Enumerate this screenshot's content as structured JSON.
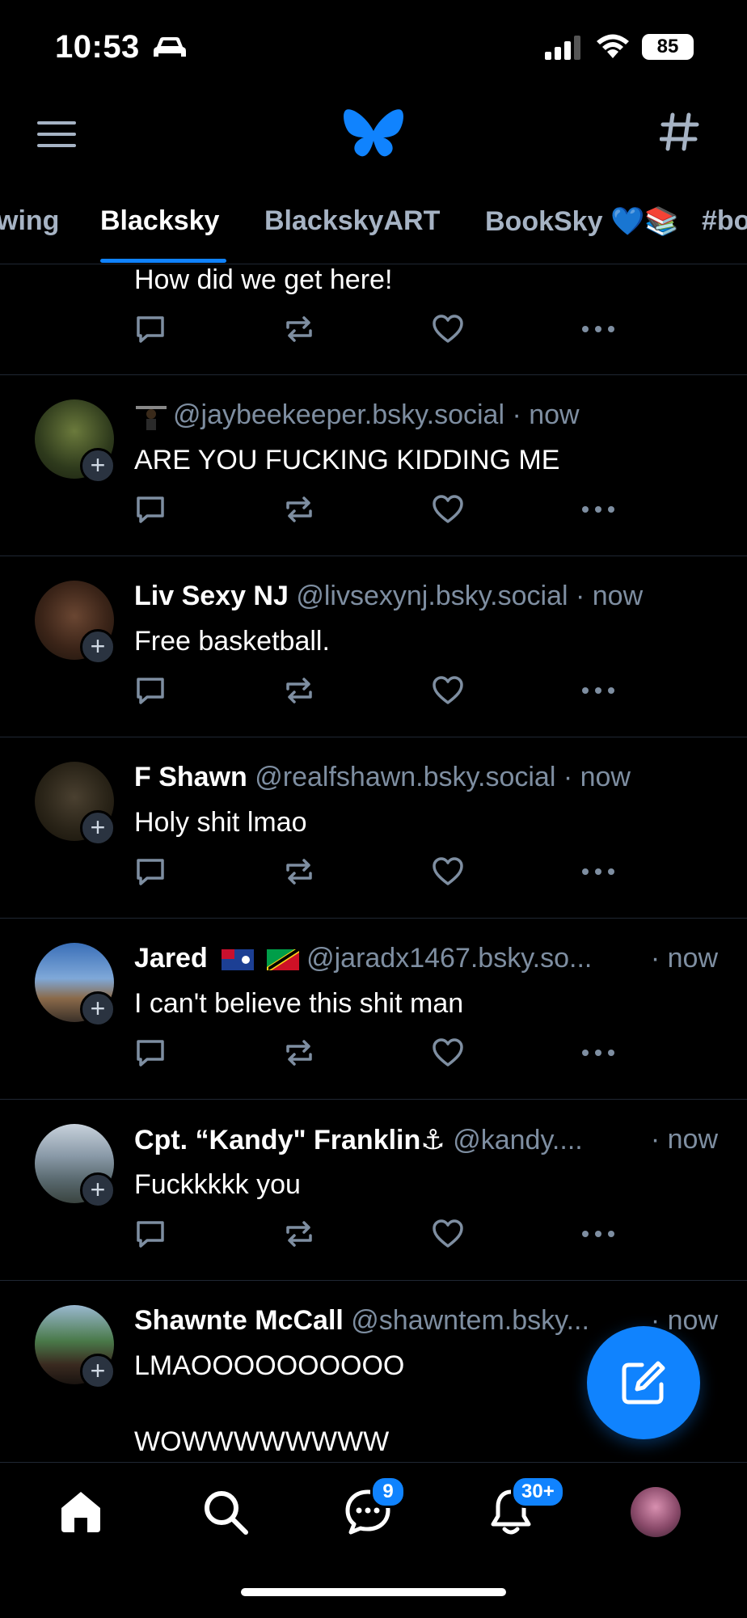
{
  "status": {
    "time": "10:53",
    "battery": "85"
  },
  "tabs": [
    "wing",
    "Blacksky",
    "BlackskyART",
    "BookSky 💙📚",
    "#bo"
  ],
  "colors": {
    "accent": "#1083fe",
    "muted": "#7e8ea1",
    "background": "#000000"
  },
  "top_post": {
    "text": "How did we get here!"
  },
  "posts": [
    {
      "name": "",
      "handle": "@jaybeekeeper.bsky.social · now",
      "time": "",
      "text": "ARE YOU FUCKING KIDDING ME"
    },
    {
      "name": "Liv Sexy NJ",
      "handle": "@livsexynj.bsky.social · now",
      "time": "",
      "text": "Free basketball."
    },
    {
      "name": "F Shawn",
      "handle": "@realfshawn.bsky.social · now",
      "time": "",
      "text": "Holy shit lmao"
    },
    {
      "name": "Jared",
      "handle": "@jaradx1467.bsky.so...",
      "time": "· now",
      "text": "I can't believe this shit man"
    },
    {
      "name": "Cpt. “Kandy\" Franklin⚓",
      "handle": "@kandy....",
      "time": "· now",
      "text": "Fuckkkkk you"
    },
    {
      "name": "Shawnte McCall",
      "handle": "@shawntem.bsky...",
      "time": "· now",
      "text": "LMAOOOOOOOOOO",
      "text2": "WOWWWWWWWW"
    }
  ],
  "nav": {
    "messages_badge": "9",
    "notifications_badge": "30+"
  },
  "icons": [
    "menu-icon",
    "butterfly-logo-icon",
    "hashtag-icon",
    "reply-icon",
    "repost-icon",
    "like-icon",
    "more-icon",
    "compose-icon",
    "home-icon",
    "search-icon",
    "chat-icon",
    "bell-icon"
  ]
}
